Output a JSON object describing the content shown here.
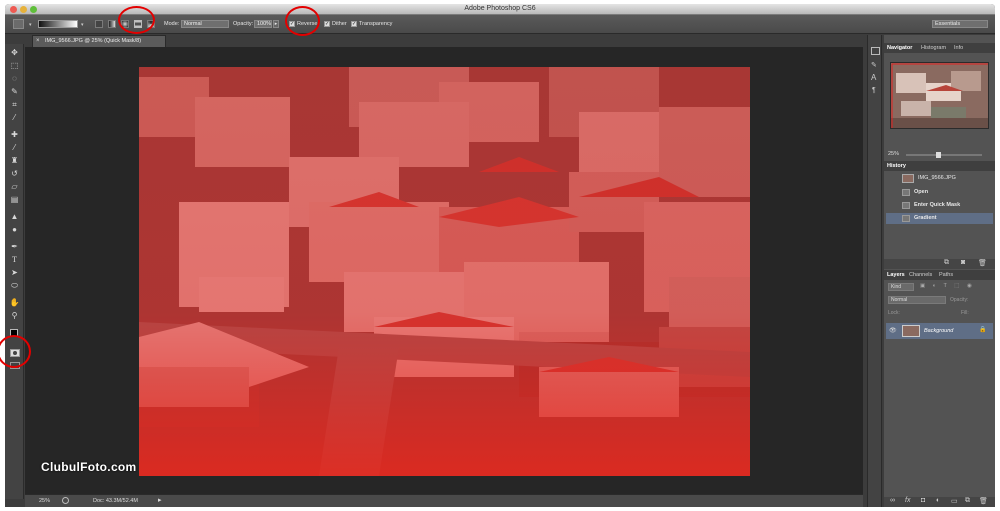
{
  "app": {
    "title": "Adobe Photoshop CS6"
  },
  "options_bar": {
    "mode_label": "Mode:",
    "mode_value": "Normal",
    "opacity_label": "Opacity:",
    "opacity_value": "100%",
    "reverse_label": "Reverse",
    "dither_label": "Dither",
    "transparency_label": "Transparency",
    "reverse_checked": true,
    "dither_checked": true,
    "transparency_checked": true,
    "workspace": "Essentials"
  },
  "document": {
    "tab_title": "IMG_9566.JPG @ 25% (Quick Mask/8)",
    "close_glyph": "×",
    "quick_mask_color": "#e02020"
  },
  "status_bar": {
    "zoom": "25%",
    "doc_info": "Doc: 43.3M/52.4M"
  },
  "navigator": {
    "tabs": [
      "Navigator",
      "Histogram",
      "Info"
    ],
    "zoom": "25%"
  },
  "history": {
    "tab": "History",
    "snapshot": "IMG_9566.JPG",
    "steps": [
      "Open",
      "Enter Quick Mask",
      "Gradient"
    ],
    "selected_step": "Gradient"
  },
  "layers": {
    "tabs": [
      "Layers",
      "Channels",
      "Paths"
    ],
    "kind_filter": "Kind",
    "blend_mode": "Normal",
    "opacity_label": "Opacity:",
    "lock_label": "Lock:",
    "fill_label": "Fill:",
    "layer_name": "Background"
  },
  "watermark": "ClubulFoto.com",
  "annotation_color": "#e30000"
}
